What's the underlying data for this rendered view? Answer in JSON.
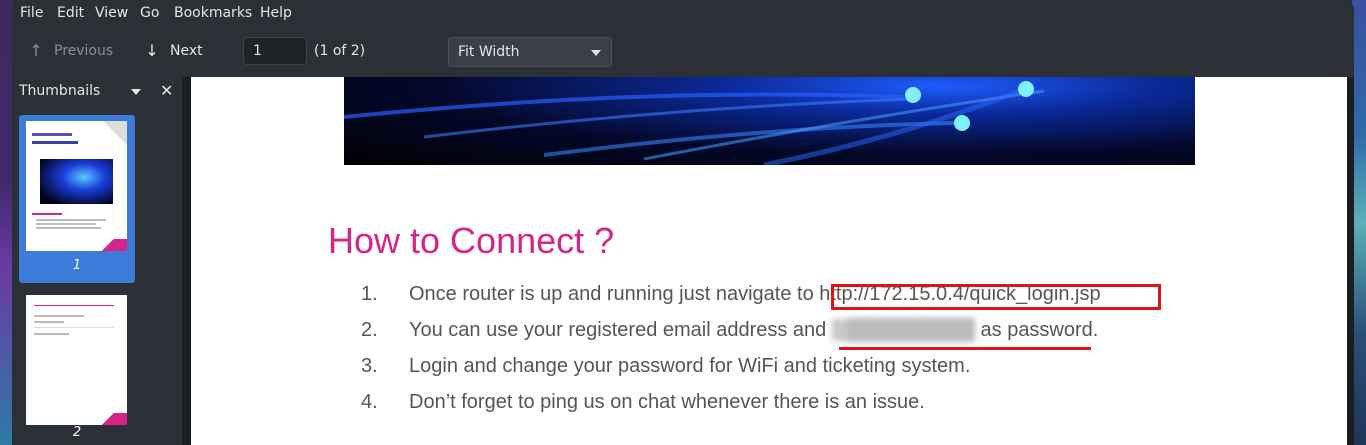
{
  "menu": [
    "File",
    "Edit",
    "View",
    "Go",
    "Bookmarks",
    "Help"
  ],
  "toolbar": {
    "previous_label": "Previous",
    "next_label": "Next",
    "page_value": "1",
    "page_count": "(1 of 2)",
    "zoom": "Fit Width"
  },
  "sidebar": {
    "title": "Thumbnails",
    "thumbnails": [
      {
        "label": "1",
        "selected": true
      },
      {
        "label": "2",
        "selected": false
      }
    ]
  },
  "document": {
    "heading": "How to Connect ?",
    "steps": [
      {
        "num": "1.",
        "text": "Once router is up and running just navigate to http://172.15.0.4/quick_login.jsp"
      },
      {
        "num": "2.",
        "pre": "You can use your registered email address and ",
        "post": " as password."
      },
      {
        "num": "3.",
        "text": "Login and change your password for WiFi and ticketing system."
      },
      {
        "num": "4.",
        "text": "Don’t forget to ping us on chat whenever there is an issue."
      }
    ]
  },
  "colors": {
    "heading": "#d6258a",
    "selection": "#3d7bd8",
    "annotation": "#e01414"
  }
}
